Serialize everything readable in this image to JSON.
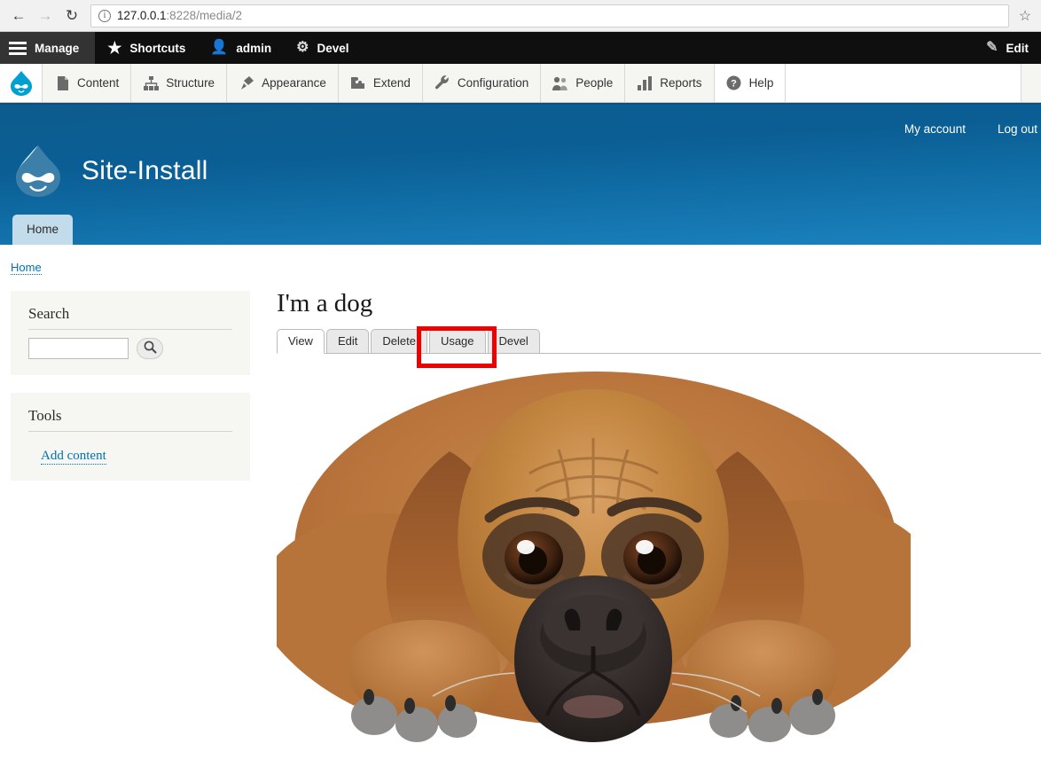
{
  "browser": {
    "back_icon": "back-arrow-icon",
    "forward_icon": "forward-arrow-icon",
    "reload_icon": "reload-icon",
    "site_info_icon": "site-info-icon",
    "url_host": "127.0.0.1",
    "url_path": ":8228/media/2",
    "url_full": "127.0.0.1:8228/media/2",
    "bookmark_icon": "star-icon"
  },
  "admin_toolbar": {
    "manage": "Manage",
    "shortcuts": "Shortcuts",
    "account": "admin",
    "devel": "Devel",
    "edit_right": "Edit",
    "background": "#0f0f0f"
  },
  "admin_menu": {
    "logo": "drupal-drop-logo",
    "items": [
      {
        "label": "Content",
        "icon": "document-icon"
      },
      {
        "label": "Structure",
        "icon": "sitemap-icon"
      },
      {
        "label": "Appearance",
        "icon": "paintbrush-icon"
      },
      {
        "label": "Extend",
        "icon": "puzzle-piece-icon"
      },
      {
        "label": "Configuration",
        "icon": "wrench-icon"
      },
      {
        "label": "People",
        "icon": "people-icon"
      },
      {
        "label": "Reports",
        "icon": "bar-chart-icon"
      },
      {
        "label": "Help",
        "icon": "question-mark-icon"
      }
    ]
  },
  "site_header": {
    "site_name": "Site-Install",
    "logo": "drupal-drop-logo",
    "my_account": "My account",
    "log_out": "Log out",
    "home_tab": "Home",
    "accent_blue": "#0d5c8f",
    "home_tab_color": "#c3dcec"
  },
  "breadcrumb": {
    "home": "Home"
  },
  "sidebar": {
    "search_block": {
      "title": "Search",
      "input_value": "",
      "input_placeholder": "",
      "button_icon": "magnifier-icon"
    },
    "tools_block": {
      "title": "Tools",
      "links": [
        {
          "label": "Add content"
        }
      ]
    }
  },
  "main": {
    "page_title": "I'm a dog",
    "tabs": [
      {
        "label": "View",
        "active": true,
        "highlighted": false
      },
      {
        "label": "Edit",
        "active": false,
        "highlighted": false
      },
      {
        "label": "Delete",
        "active": false,
        "highlighted": false
      },
      {
        "label": "Usage",
        "active": false,
        "highlighted": true
      },
      {
        "label": "Devel",
        "active": false,
        "highlighted": false
      }
    ],
    "highlight_color": "#ee0000",
    "media": {
      "alt": "Photograph of a brown boxer puppy lying down facing the camera",
      "name": "dog-photo"
    }
  }
}
